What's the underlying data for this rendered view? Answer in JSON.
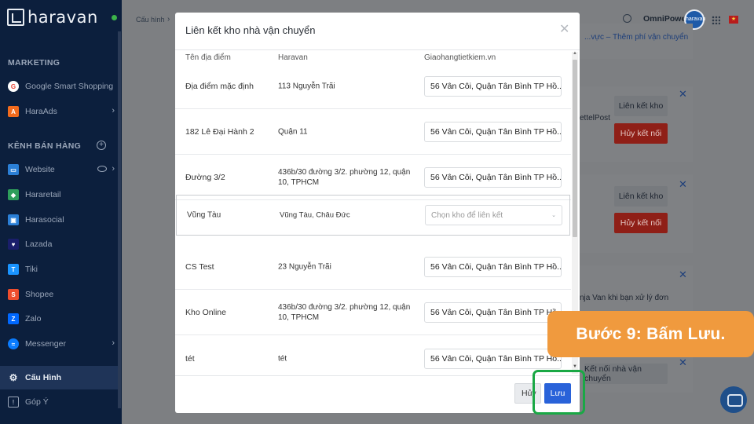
{
  "app": {
    "logo_text": "haravan"
  },
  "sidebar": {
    "marketing_title": "MARKETING",
    "marketing_items": [
      {
        "label": "Google Smart Shopping",
        "icon": "google-icon",
        "color": "#ea4335"
      },
      {
        "label": "HaraAds",
        "icon": "haraads-icon",
        "color": "#f26b1d"
      }
    ],
    "channels_title": "KÊNH BÁN HÀNG",
    "channel_items": [
      {
        "label": "Website",
        "icon": "website-icon",
        "color": "#2b7fd6"
      },
      {
        "label": "Hararetail",
        "icon": "hararetail-icon",
        "color": "#2e9e5b"
      },
      {
        "label": "Harasocial",
        "icon": "harasocial-icon",
        "color": "#2b7fd6"
      },
      {
        "label": "Lazada",
        "icon": "lazada-icon",
        "color": "#1a1e6b"
      },
      {
        "label": "Tiki",
        "icon": "tiki-icon",
        "color": "#1a94ff"
      },
      {
        "label": "Shopee",
        "icon": "shopee-icon",
        "color": "#ee4d2d"
      },
      {
        "label": "Zalo",
        "icon": "zalo-icon",
        "color": "#0068ff"
      },
      {
        "label": "Messenger",
        "icon": "messenger-icon",
        "color": "#0a7cff"
      }
    ],
    "config_label": "Cấu Hình",
    "feedback_label": "Góp Ý"
  },
  "topbar": {
    "breadcrumb": "Cấu hình",
    "breadcrumb_sep": "›",
    "user_name": "OmniPower",
    "avatar_text": "haravan"
  },
  "background": {
    "link_text": "...vực – Thêm phí vận chuyển",
    "card1": {
      "text": "ettelPost",
      "link_button": "Liên kết kho",
      "disconnect_button": "Hủy kết nối"
    },
    "card2": {
      "link_button": "Liên kết kho",
      "disconnect_button": "Hủy kết nối"
    },
    "card3": {
      "text": "nja Van khi bạn xử lý đơn"
    },
    "card4": {
      "connect_button": "Kết nối nhà vận chuyển"
    },
    "close_symbol": "✕"
  },
  "modal": {
    "title": "Liên kết kho nhà vận chuyển",
    "close_symbol": "✕",
    "columns": [
      "Tên địa điểm",
      "Haravan",
      "Giaohangtietkiem.vn"
    ],
    "rows": [
      {
        "name": "Địa điểm mặc định",
        "haravan": "113 Nguyễn Trãi",
        "warehouse": "56 Vân Côi, Quận Tân Bình TP Hồ..."
      },
      {
        "name": "182 Lê Đại Hành 2",
        "haravan": "Quận 11",
        "warehouse": "56 Vân Côi, Quận Tân Bình TP Hồ..."
      },
      {
        "name": "Đường 3/2",
        "haravan": "436b/30 đường 3/2. phường 12, quận 10, TPHCM",
        "warehouse": "56 Vân Côi, Quận Tân Bình TP Hồ..."
      },
      {
        "name": "Vũng Tàu",
        "haravan": "Vũng Tàu, Châu Đức",
        "warehouse_placeholder": "Chọn kho để liên kết"
      },
      {
        "name": "CS Test",
        "haravan": "23 Nguyễn Trãi",
        "warehouse": "56 Vân Côi, Quận Tân Bình TP Hồ..."
      },
      {
        "name": "Kho Online",
        "haravan": "436b/30 đường 3/2. phường 12, quận 10, TPHCM",
        "warehouse": "56 Vân Côi, Quận Tân Bình TP Hồ..."
      },
      {
        "name": "tét",
        "haravan": "tét",
        "warehouse": "56 Vân Côi, Quận Tân Bình TP Hồ..."
      }
    ],
    "cancel_label": "Hủy",
    "save_label": "Lưu",
    "caret_symbol": "⌄"
  },
  "tutorial": {
    "step_text": "Bước 9: Bấm Lưu."
  },
  "colors": {
    "primary": "#2962d9",
    "step_orange": "#f09a3e",
    "highlight_green": "#1aa845",
    "sidebar_bg": "#0c1f3d"
  }
}
